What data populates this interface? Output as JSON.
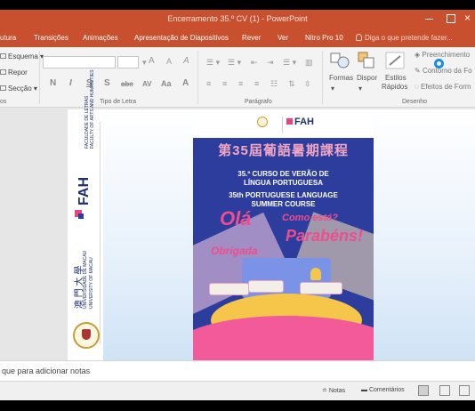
{
  "window": {
    "title": "Encerramento 35.º CV (1) - PowerPoint"
  },
  "tabs": [
    {
      "label": "utura"
    },
    {
      "label": "Transições"
    },
    {
      "label": "Animações"
    },
    {
      "label": "Apresentação de Diapositivos"
    },
    {
      "label": "Rever"
    },
    {
      "label": "Ver"
    },
    {
      "label": "Nitro Pro 10"
    }
  ],
  "tell_me": "Diga o que pretende fazer...",
  "ribbon": {
    "slides": {
      "esquema": "Esquema",
      "repor": "Repor",
      "seccao": "Secção",
      "group_label": "os"
    },
    "font": {
      "group_label": "Tipo de Letra",
      "bold": "N",
      "italic": "I",
      "underline": "S",
      "strike": "S",
      "abc": "abc",
      "spacing": "AV",
      "case": "Aa",
      "grow": "A",
      "shrink": "A",
      "clear": "A"
    },
    "paragraph": {
      "group_label": "Parágrafo"
    },
    "drawing": {
      "group_label": "Desenho",
      "formas": "Formas",
      "dispor": "Dispor",
      "estilos": "Estilos",
      "rapidos": "Rápidos",
      "preenchimento": "Preenchimento",
      "contorno": "Contorno da Fo",
      "efeitos": "Efeitos de Form"
    }
  },
  "slide": {
    "fah_vertical": "FAH",
    "faculty_en": "FACULTY OF ARTS AND HUMANITIES",
    "faculty_pt": "FACULDADE DE LETRAS",
    "university_en": "UNIVERSITY OF MACAU",
    "university_pt": "UNIVERSIDADE DE MACAU",
    "university_cn": "澳 門 大 學",
    "poster": {
      "fah": "FAH",
      "title_cn": "第35屆葡語暑期課程",
      "title_pt_1": "35.º CURSO DE VERÃO DE",
      "title_pt_2": "LÍNGUA PORTUGUESA",
      "title_en_1": "35th PORTUGUESE LANGUAGE",
      "title_en_2": "SUMMER COURSE",
      "ola": "Olá",
      "como": "Como está?",
      "parabens": "Parabéns!",
      "obrigada": "Obrigada"
    }
  },
  "notes": {
    "placeholder": "que para adicionar notas"
  },
  "status": {
    "notas": "Notas",
    "comentarios": "Comentários"
  },
  "colors": {
    "accent": "#c9502e",
    "poster_bg": "#2d3d9e",
    "pink": "#ee4d8e"
  }
}
